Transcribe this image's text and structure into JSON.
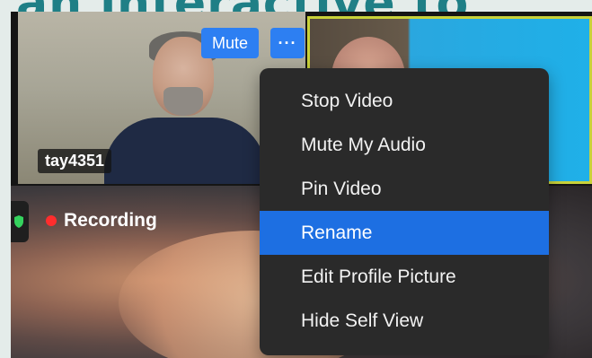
{
  "banner": {
    "text": "an interactive to"
  },
  "tile_left": {
    "name": "tay4351",
    "mute_label": "Mute",
    "more_label": "···"
  },
  "recording": {
    "label": "Recording"
  },
  "menu": {
    "items": [
      {
        "label": "Stop Video"
      },
      {
        "label": "Mute My Audio"
      },
      {
        "label": "Pin Video"
      },
      {
        "label": "Rename",
        "active": true
      },
      {
        "label": "Edit Profile Picture"
      },
      {
        "label": "Hide Self View"
      }
    ]
  },
  "colors": {
    "accent": "#2d7ff2",
    "menu_bg": "#2a2a2a",
    "menu_active": "#1d6fe2",
    "active_border": "#c9d23a",
    "recording_dot": "#ff2d2d",
    "banner": "#1f7f86"
  },
  "icons": {
    "more": "more-dots-icon",
    "recording": "recording-dot-icon",
    "shield": "shield-icon"
  }
}
